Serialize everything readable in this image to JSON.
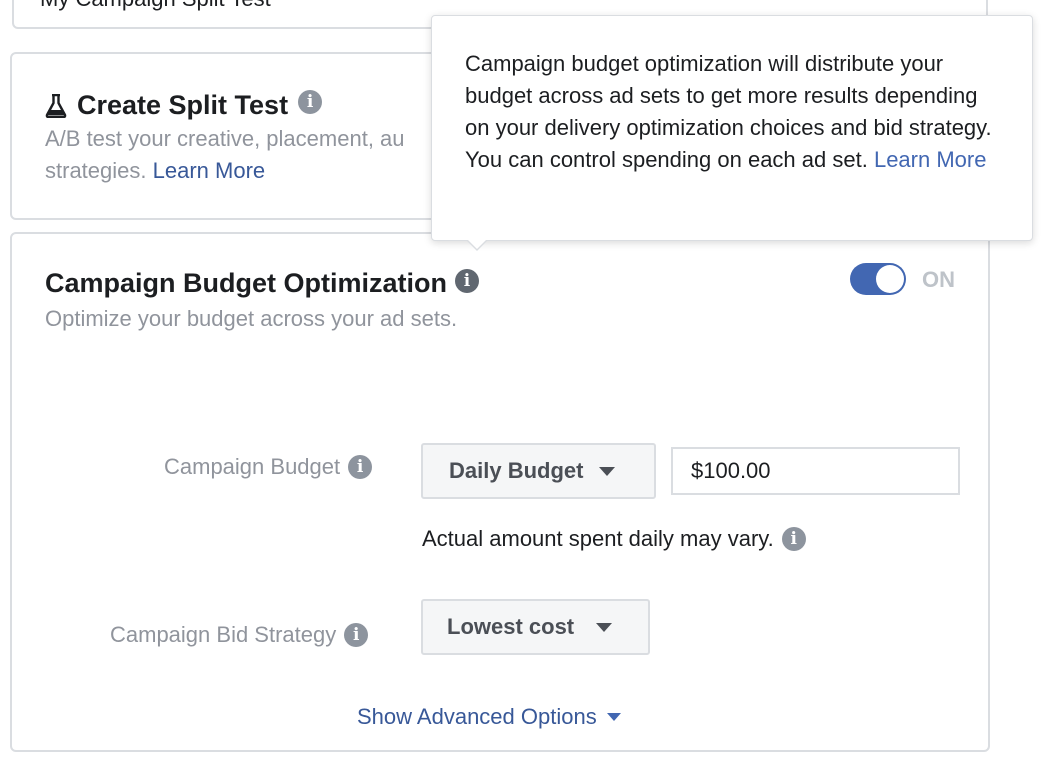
{
  "campaign_name": {
    "value": "My Campaign Split Test"
  },
  "split_test": {
    "title": "Create Split Test",
    "info_glyph": "i",
    "description": "A/B test your creative, placement, au",
    "description_line2": "strategies.",
    "learn_more": "Learn More"
  },
  "cbo": {
    "title": "Campaign Budget Optimization",
    "info_glyph": "i",
    "subtitle": "Optimize your budget across your ad sets.",
    "toggle": {
      "state": "ON",
      "on": true
    },
    "budget": {
      "label": "Campaign Budget",
      "type_selected": "Daily Budget",
      "amount": "$100.00",
      "note": "Actual amount spent daily may vary."
    },
    "bid_strategy": {
      "label": "Campaign Bid Strategy",
      "selected": "Lowest cost"
    },
    "advanced_link": "Show Advanced Options"
  },
  "tooltip": {
    "text": "Campaign budget optimization will distribute your budget across ad sets to get more results depending on your delivery optimization choices and bid strategy. You can control spending on each ad set.",
    "learn_more": "Learn More"
  },
  "icons": {
    "flask": "flask-icon",
    "info": "info-icon",
    "caret": "caret-down-icon"
  },
  "colors": {
    "accent": "#4267b2",
    "link": "#385898",
    "muted_text": "#90949c",
    "border": "#dadde1"
  }
}
